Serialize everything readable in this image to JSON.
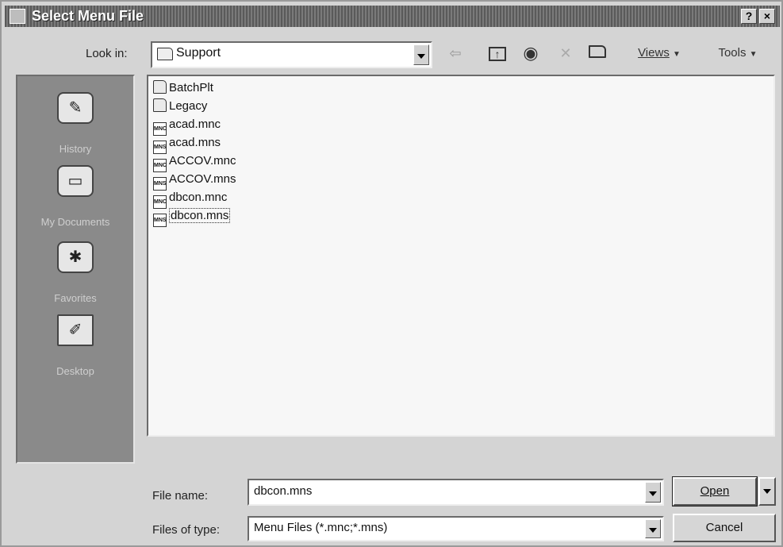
{
  "title": "Select Menu File",
  "title_buttons": {
    "help": "?",
    "close": "×"
  },
  "look_in": {
    "label": "Look in:",
    "value": "Support"
  },
  "toolbar": {
    "views": "Views",
    "tools": "Tools"
  },
  "places": [
    {
      "label": "History"
    },
    {
      "label": "My Documents"
    },
    {
      "label": "Favorites"
    },
    {
      "label": "Desktop"
    }
  ],
  "files": [
    {
      "name": "BatchPlt",
      "type": "folder"
    },
    {
      "name": "Legacy",
      "type": "folder"
    },
    {
      "name": "acad.mnc",
      "type": "mnc"
    },
    {
      "name": "acad.mns",
      "type": "mns"
    },
    {
      "name": "ACCOV.mnc",
      "type": "mnc"
    },
    {
      "name": "ACCOV.mns",
      "type": "mns"
    },
    {
      "name": "dbcon.mnc",
      "type": "mnc"
    },
    {
      "name": "dbcon.mns",
      "type": "mns",
      "selected": true
    }
  ],
  "file_name": {
    "label": "File name:",
    "value": "dbcon.mns"
  },
  "file_type": {
    "label": "Files of type:",
    "value": "Menu Files (*.mnc;*.mns)"
  },
  "buttons": {
    "open": "Open",
    "cancel": "Cancel"
  },
  "icon_text": {
    "mns": "MNS",
    "mnc": "MNC"
  }
}
